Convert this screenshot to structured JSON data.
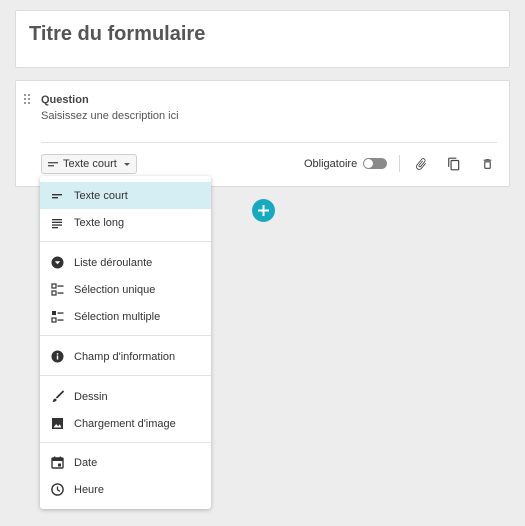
{
  "form": {
    "title": "Titre du formulaire"
  },
  "question": {
    "label": "Question",
    "description_placeholder": "Saisissez une description ici",
    "type_selected": "Texte court",
    "required_label": "Obligatoire",
    "required_on": false
  },
  "type_menu": {
    "items": [
      {
        "label": "Texte court",
        "icon": "short-text-icon",
        "active": true
      },
      {
        "label": "Texte long",
        "icon": "long-text-icon"
      },
      {
        "label": "Liste déroulante",
        "icon": "dropdown-icon"
      },
      {
        "label": "Sélection unique",
        "icon": "single-choice-icon"
      },
      {
        "label": "Sélection multiple",
        "icon": "multiple-choice-icon"
      },
      {
        "label": "Champ d'information",
        "icon": "info-icon"
      },
      {
        "label": "Dessin",
        "icon": "drawing-icon"
      },
      {
        "label": "Chargement d'image",
        "icon": "image-icon"
      },
      {
        "label": "Date",
        "icon": "calendar-icon"
      },
      {
        "label": "Heure",
        "icon": "clock-icon"
      }
    ]
  },
  "colors": {
    "accent": "#17a9c2",
    "active_item_bg": "#d5eef4",
    "background": "#ededed"
  }
}
